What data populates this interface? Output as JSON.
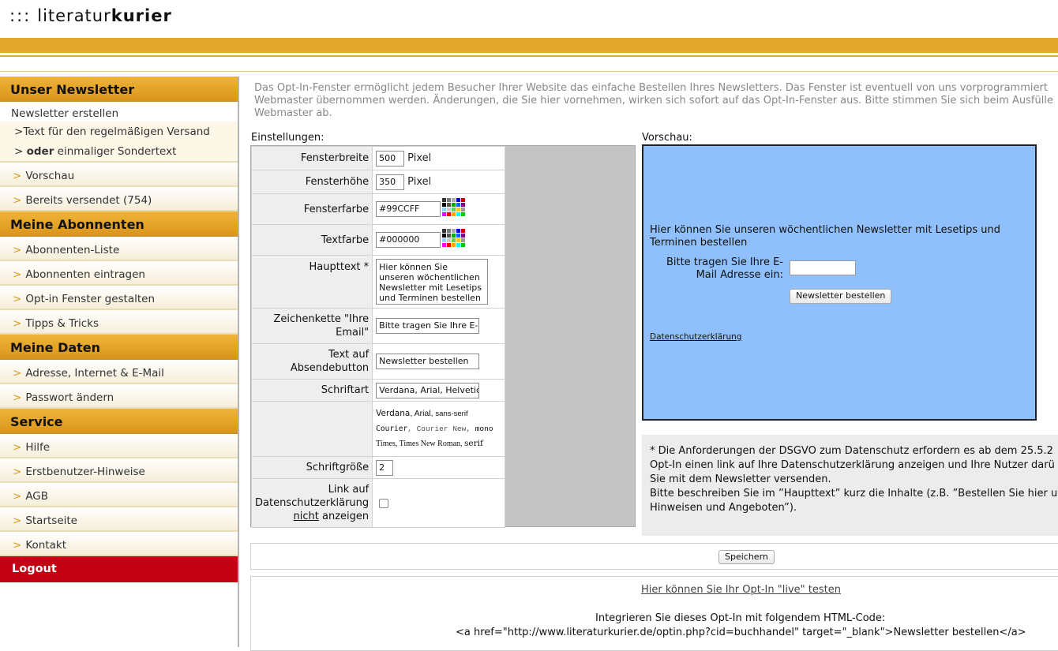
{
  "logo": {
    "dots": ":::",
    "part1": "literatur",
    "part2": "kurier"
  },
  "sidebar": {
    "section1": "Unser Newsletter",
    "create": "Newsletter erstellen",
    "regular_text": "Text für den regelmäßigen Versand",
    "or_bold": "oder",
    "or_rest": "einmaliger Sondertext",
    "preview": "Vorschau",
    "sent": "Bereits versendet (754)",
    "section2": "Meine Abonnenten",
    "subscriber_list": "Abonnenten-Liste",
    "add_subscribers": "Abonnenten eintragen",
    "optin_design": "Opt-in Fenster gestalten",
    "tips": "Tipps & Tricks",
    "section3": "Meine Daten",
    "address": "Adresse, Internet & E-Mail",
    "password": "Passwort ändern",
    "section4": "Service",
    "help": "Hilfe",
    "firstuser": "Erstbenutzer-Hinweise",
    "agb": "AGB",
    "home": "Startseite",
    "contact": "Kontakt",
    "logout": "Logout"
  },
  "intro": {
    "line1": "Das Opt-In-Fenster ermöglicht jedem Besucher Ihrer Website das einfache Bestellen Ihres Newsletters. Das Fenster ist eventuell von uns vorprogrammiert",
    "line2": "Webmaster übernommen werden. Änderungen, die Sie hier vornehmen, wirken sich sofort auf das Opt-In-Fenster aus. Bitte stimmen Sie sich beim Ausfülle",
    "line3": "Webmaster ab."
  },
  "settings": {
    "heading": "Einstellungen:",
    "width_label": "Fensterbreite",
    "width_value": "500",
    "pixel_unit": "Pixel",
    "height_label": "Fensterhöhe",
    "height_value": "350",
    "bgcolor_label": "Fensterfarbe",
    "bgcolor_value": "#99CCFF",
    "textcolor_label": "Textfarbe",
    "textcolor_value": "#000000",
    "maintext_label": "Haupttext *",
    "maintext_value": "Hier können Sie unseren wöchentlichen Newsletter mit Lesetips und Terminen bestellen",
    "emailstring_label": "Zeichenkette \"Ihre Email\"",
    "emailstring_value": "Bitte tragen Sie Ihre E-Ma",
    "button_label": "Text auf Absendebutton",
    "button_value": "Newsletter bestellen",
    "font_label": "Schriftart",
    "font_value": "Verdana, Arial, Helvetica",
    "font_demo1a": "Verdana",
    "font_demo1b": ", Arial, ",
    "font_demo1c": "sans-serif",
    "font_demo2a": "Courier",
    "font_demo2b": ", Courier New, ",
    "font_demo2c": "mono",
    "font_demo3a": "Times, Times New Roman, ",
    "font_demo3b": "serif",
    "fontsize_label": "Schriftgröße",
    "fontsize_value": "2",
    "privacy_label1": "Link auf",
    "privacy_label2": "Datenschutzerklärung",
    "privacy_nicht": "nicht",
    "privacy_label3": " anzeigen"
  },
  "preview": {
    "heading": "Vorschau:",
    "text": "Hier können Sie unseren wöchentlichen Newsletter mit Lesetips und Terminen bestellen",
    "email_label": "Bitte tragen Sie Ihre E-Mail Adresse ein:",
    "button": "Newsletter bestellen",
    "privacy_link": "Datenschutzerklärung",
    "bg_color": "#8FC0FB"
  },
  "notice": {
    "line1": "* Die Anforderungen der DSGVO zum Datenschutz erfordern es ab dem 25.5.2",
    "line2": "Opt-In einen link auf Ihre Datenschutzerklärung anzeigen und Ihre Nutzer darü",
    "line3": "Sie mit dem Newsletter versenden.",
    "line4": "Bitte beschreiben Sie im ”Haupttext” kurz die Inhalte (z.B. ”Bestellen Sie hier u",
    "line5": "Hinweisen und Angeboten”)."
  },
  "save_button": "Speichern",
  "bottom": {
    "test_link": "Hier können Sie Ihr Opt-In \"live\" testen",
    "integrate_text": "Integrieren Sie dieses Opt-In mit folgendem HTML-Code:",
    "code": "<a href=\"http://www.literaturkurier.de/optin.php?cid=buchhandel\" target=\"_blank\">Newsletter bestellen</a>"
  },
  "colors": {
    "accent": "#E2A92D",
    "logout": "#C40014",
    "preview_bg": "#8FC0FB"
  }
}
